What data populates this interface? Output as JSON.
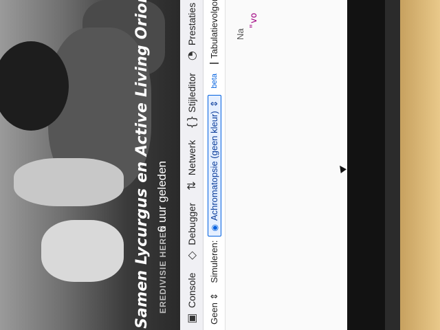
{
  "article": {
    "headline": "Samen Lycurgus en Active Living Orion spelen o",
    "category": "EREDIVISIE HEREN",
    "time_ago": "6 uur geleden"
  },
  "devtools": {
    "tabs": [
      {
        "label": "Console",
        "icon": "console-icon"
      },
      {
        "label": "Debugger",
        "icon": "debugger-icon"
      },
      {
        "label": "Netwerk",
        "icon": "network-icon"
      },
      {
        "label": "Stijleditor",
        "icon": "style-editor-icon"
      },
      {
        "label": "Prestaties",
        "icon": "performance-icon"
      }
    ],
    "simulation": {
      "none_label": "Geen",
      "simulate_label": "Simuleren:",
      "selected": "Achromatopsie (geen kleur)",
      "beta": "beta",
      "checkbox_label": "Tabulatievolgord"
    },
    "right_pane": {
      "name_label": "Na",
      "string_value": "\"vo"
    }
  },
  "colors": {
    "accent": "#0060df",
    "string": "#a00080"
  }
}
